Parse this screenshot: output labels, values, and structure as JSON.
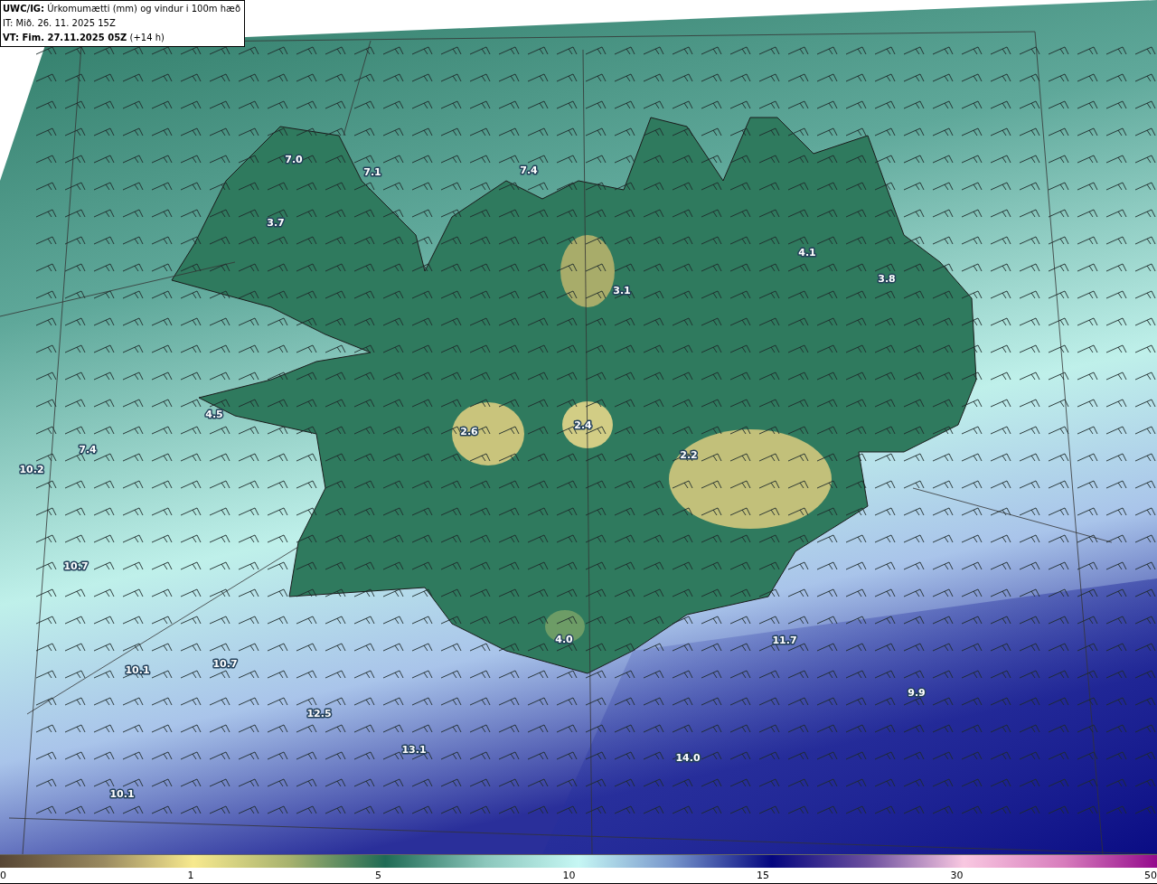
{
  "header": {
    "title": "**UWC/IG:** Úrkomumætti (mm) og vindur i 100m hæð",
    "issue_time": "IT: Mið. 26. 11. 2025 15Z",
    "valid_time": "**VT: Fim. 27.11.2025 05Z** (+14 h)"
  },
  "map": {
    "value_labels": [
      "7.0",
      "7.1",
      "7.4",
      "3.7",
      "4.1",
      "3.8",
      "3.1",
      "4.5",
      "7.4",
      "10.2",
      "2.6",
      "2.4",
      "2.2",
      "10.7",
      "4.0",
      "11.7",
      "10.1",
      "10.7",
      "9.9",
      "12.5",
      "13.1",
      "14.0",
      "10.1"
    ]
  },
  "colorbar": {
    "ticks": [
      "0",
      "1",
      "5",
      "10",
      "15",
      "30",
      "50"
    ]
  }
}
